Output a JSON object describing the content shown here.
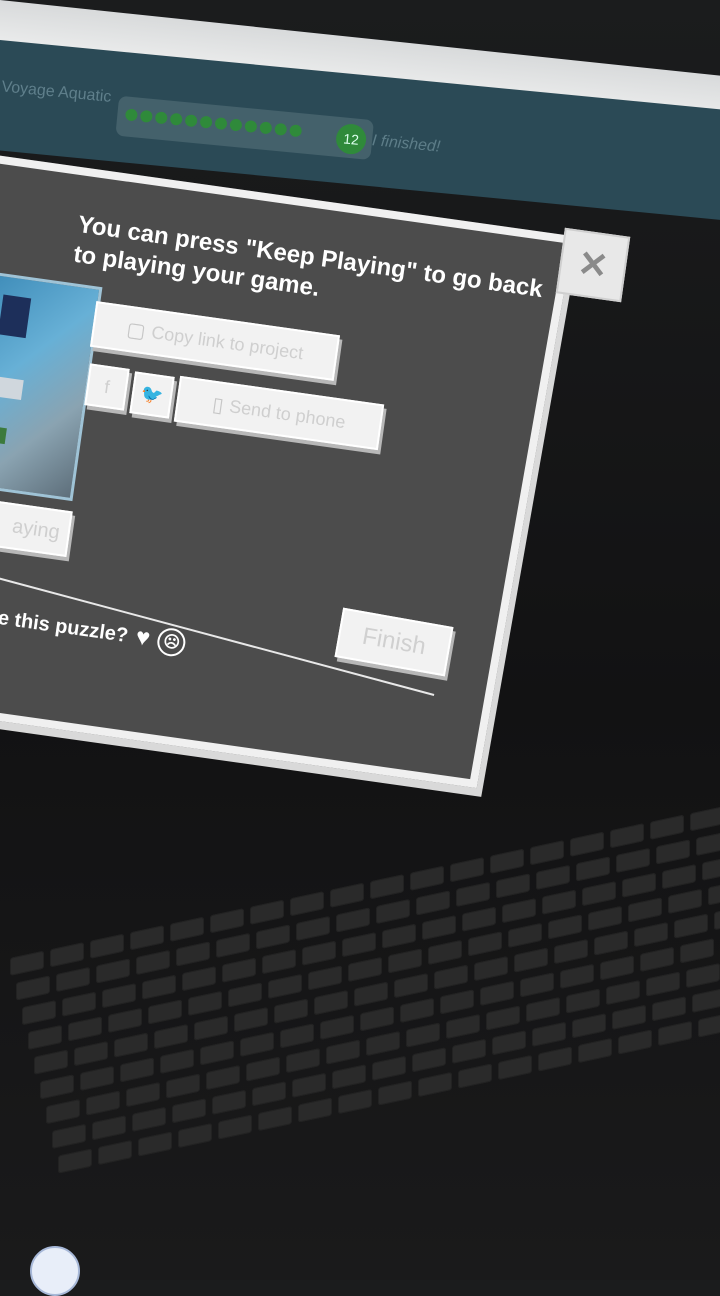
{
  "header": {
    "title": "Voyage Aquatic",
    "level_number": "12",
    "finished_label": "I finished!"
  },
  "dialog": {
    "message": "You can press \"Keep Playing\" to go back to playing your game.",
    "copy_link_label": "Copy link to project",
    "send_to_phone_label": "Send to phone",
    "keep_playing_label": "aying",
    "feedback_question": "e this puzzle?",
    "finish_label": "Finish",
    "close_icon_symbol": "✕",
    "facebook_icon_symbol": "f",
    "twitter_icon_symbol": "🐦",
    "phone_icon_symbol": "▯",
    "copy_icon_symbol": "▢",
    "heart_symbol": "♥",
    "sad_face_symbol": "☹"
  },
  "colors": {
    "dialog_bg": "#4c4c4c",
    "header_bg": "#2b4a56",
    "progress_green": "#2f8a3a",
    "button_bg": "#f2f2f2"
  }
}
